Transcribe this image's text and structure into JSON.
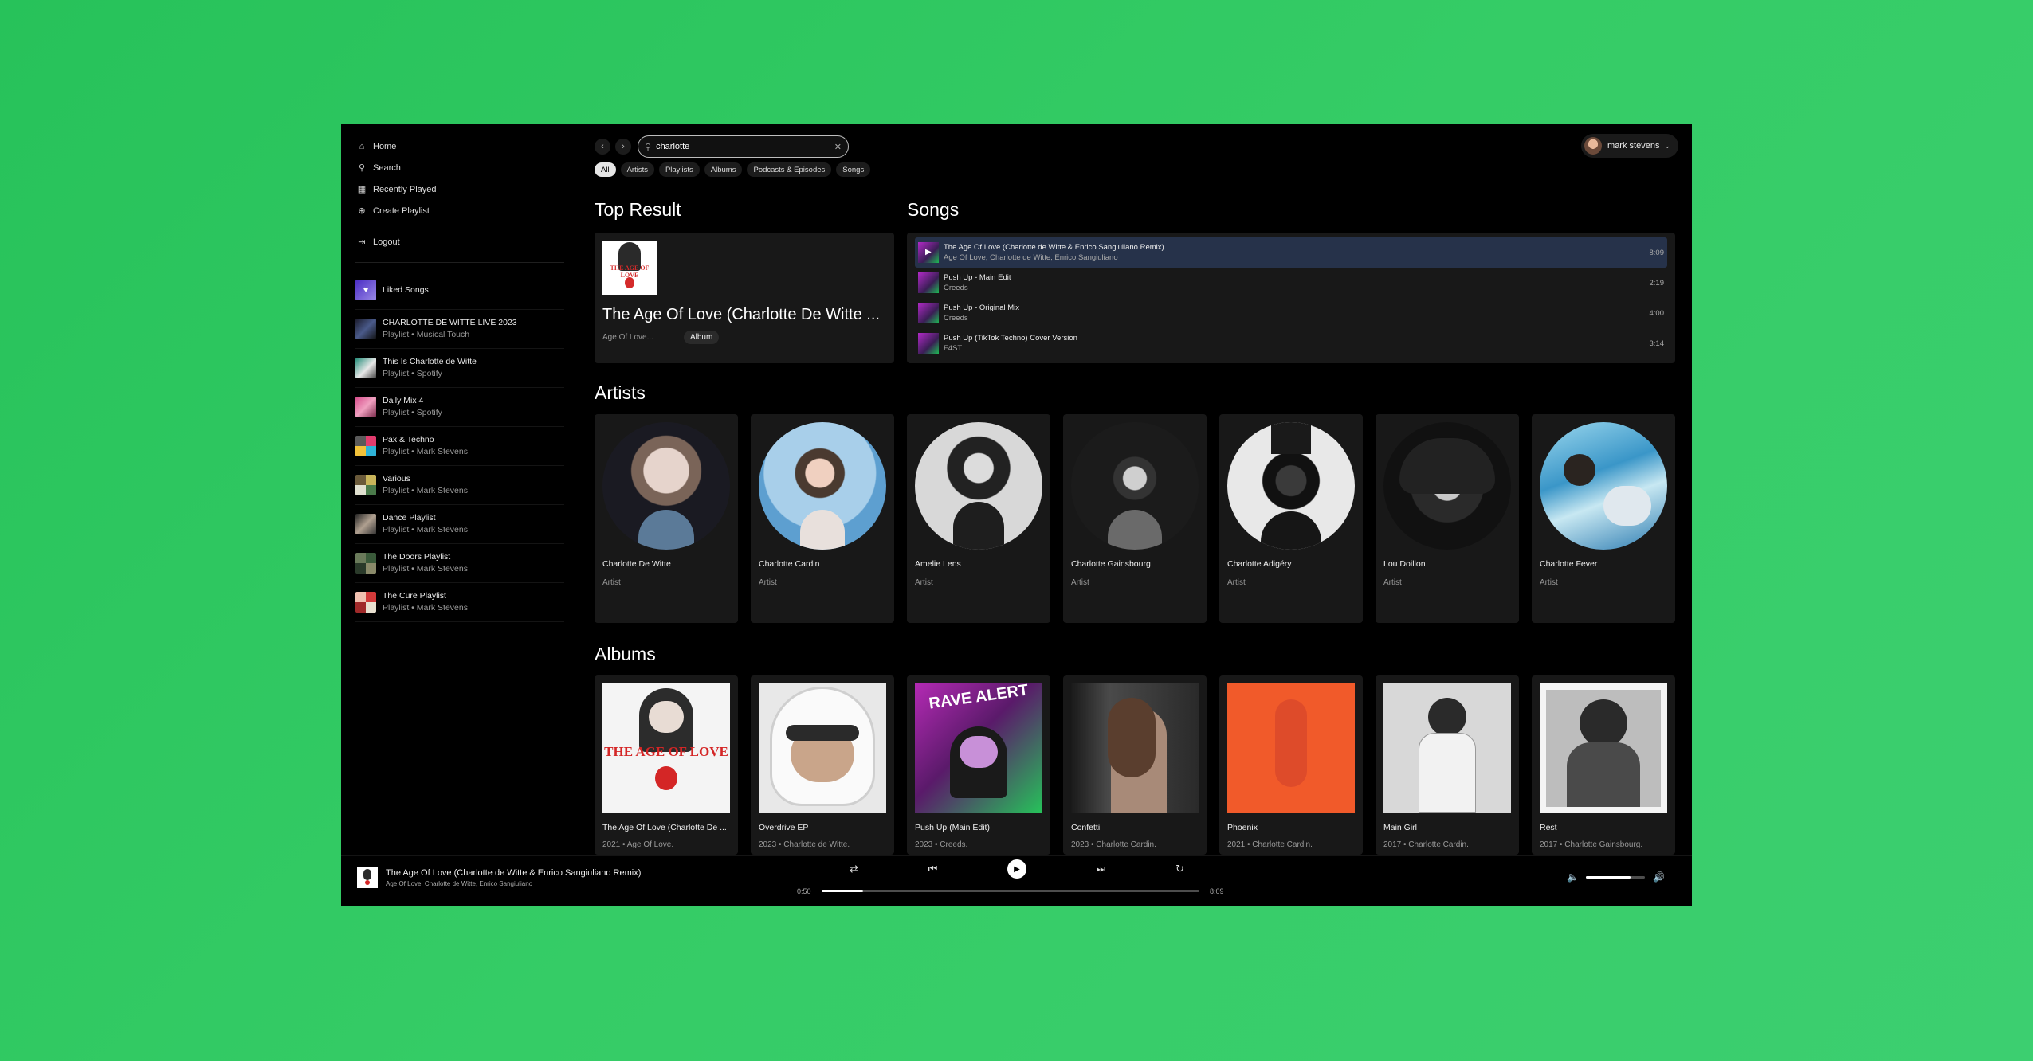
{
  "sidebar": {
    "nav": [
      {
        "label": "Home",
        "icon": "home-icon"
      },
      {
        "label": "Search",
        "icon": "search-icon"
      },
      {
        "label": "Recently Played",
        "icon": "calendar-icon"
      },
      {
        "label": "Create Playlist",
        "icon": "plus-circle-icon"
      }
    ],
    "logout": "Logout",
    "playlists": [
      {
        "title": "Liked Songs",
        "sub": ""
      },
      {
        "title": "CHARLOTTE DE WITTE LIVE 2023",
        "sub": "Playlist • Musical Touch"
      },
      {
        "title": "This Is Charlotte de Witte",
        "sub": "Playlist • Spotify"
      },
      {
        "title": "Daily Mix 4",
        "sub": "Playlist • Spotify"
      },
      {
        "title": "Pax & Techno",
        "sub": "Playlist • Mark Stevens"
      },
      {
        "title": "Various",
        "sub": "Playlist • Mark Stevens"
      },
      {
        "title": "Dance Playlist",
        "sub": "Playlist • Mark Stevens"
      },
      {
        "title": "The Doors Playlist",
        "sub": "Playlist • Mark Stevens"
      },
      {
        "title": "The Cure Playlist",
        "sub": "Playlist • Mark Stevens"
      }
    ]
  },
  "search": {
    "value": "charlotte"
  },
  "user": {
    "name": "mark stevens"
  },
  "chips": [
    "All",
    "Artists",
    "Playlists",
    "Albums",
    "Podcasts & Episodes",
    "Songs"
  ],
  "sections": {
    "top_result": "Top Result",
    "songs": "Songs",
    "artists": "Artists",
    "albums": "Albums"
  },
  "top_result": {
    "title": "The Age Of Love (Charlotte De Witte ...",
    "meta": "Age Of Love...",
    "badge": "Album"
  },
  "songs": [
    {
      "title": "The Age Of Love (Charlotte de Witte & Enrico Sangiuliano Remix)",
      "sub": "Age Of Love, Charlotte de Witte, Enrico Sangiuliano",
      "dur": "8:09"
    },
    {
      "title": "Push Up - Main Edit",
      "sub": "Creeds",
      "dur": "2:19"
    },
    {
      "title": "Push Up - Original Mix",
      "sub": "Creeds",
      "dur": "4:00"
    },
    {
      "title": "Push Up (TikTok Techno) Cover Version",
      "sub": "F4ST",
      "dur": "3:14"
    }
  ],
  "artists": [
    {
      "name": "Charlotte De Witte",
      "sub": "Artist"
    },
    {
      "name": "Charlotte Cardin",
      "sub": "Artist"
    },
    {
      "name": "Amelie Lens",
      "sub": "Artist"
    },
    {
      "name": "Charlotte Gainsbourg",
      "sub": "Artist"
    },
    {
      "name": "Charlotte Adigéry",
      "sub": "Artist"
    },
    {
      "name": "Lou Doillon",
      "sub": "Artist"
    },
    {
      "name": "Charlotte Fever",
      "sub": "Artist"
    }
  ],
  "albums": [
    {
      "name": "The Age Of Love (Charlotte De ...",
      "sub": "2021 • Age Of Love."
    },
    {
      "name": "Overdrive EP",
      "sub": "2023 • Charlotte de Witte."
    },
    {
      "name": "Push Up (Main Edit)",
      "sub": "2023 • Creeds."
    },
    {
      "name": "Confetti",
      "sub": "2023 • Charlotte Cardin."
    },
    {
      "name": "Phoenix",
      "sub": "2021 • Charlotte Cardin."
    },
    {
      "name": "Main Girl",
      "sub": "2017 • Charlotte Cardin."
    },
    {
      "name": "Rest",
      "sub": "2017 • Charlotte Gainsbourg."
    }
  ],
  "cover_text": {
    "age_of_love": "THE AGE OF LOVE",
    "rave_alert": "RAVE ALERT"
  },
  "player": {
    "title": "The Age Of Love (Charlotte de Witte & Enrico Sangiuliano Remix)",
    "artists": "Age Of Love, Charlotte de Witte, Enrico Sangiuliano",
    "elapsed": "0:50",
    "total": "8:09",
    "progress": 0.11,
    "volume": 0.75
  }
}
